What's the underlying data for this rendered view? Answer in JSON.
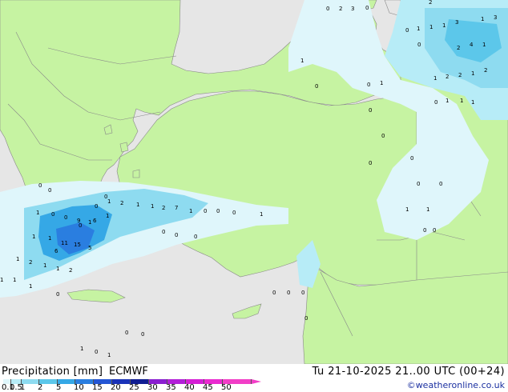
{
  "footer": {
    "title": "Precipitation [mm]",
    "model": "ECMWF",
    "datetime": "Tu 21-10-2025 21..00 UTC (00+24)",
    "credit": "©weatheronline.co.uk"
  },
  "legend": [
    {
      "label": "0.1",
      "color": "#dff6fb"
    },
    {
      "label": "0.5",
      "color": "#b7ecf7"
    },
    {
      "label": "1",
      "color": "#8edbf0"
    },
    {
      "label": "2",
      "color": "#5cc7ea"
    },
    {
      "label": "5",
      "color": "#35a8e6"
    },
    {
      "label": "10",
      "color": "#2a7ee0"
    },
    {
      "label": "15",
      "color": "#2556d4"
    },
    {
      "label": "20",
      "color": "#1a32b8"
    },
    {
      "label": "25",
      "color": "#101d92"
    },
    {
      "label": "30",
      "color": "#8a1fd0"
    },
    {
      "label": "35",
      "color": "#b21fd8"
    },
    {
      "label": "40",
      "color": "#d51fd5"
    },
    {
      "label": "45",
      "color": "#ea2ad0"
    },
    {
      "label": "50",
      "color": "#f23ec7"
    }
  ],
  "colors": {
    "sea": "#e6e6e6",
    "land": "#c6f3a2",
    "coast": "#888888",
    "border": "#888888"
  },
  "map_values": [
    {
      "t": "0"
    },
    {
      "t": "2"
    },
    {
      "t": "3"
    },
    {
      "t": "0"
    },
    {
      "t": "2"
    },
    {
      "t": "0"
    },
    {
      "t": "1"
    },
    {
      "t": "1"
    },
    {
      "t": "1"
    },
    {
      "t": "3"
    },
    {
      "t": "1"
    },
    {
      "t": "0"
    },
    {
      "t": "2"
    },
    {
      "t": "4"
    },
    {
      "t": "1"
    },
    {
      "t": "3"
    },
    {
      "t": "1"
    },
    {
      "t": "2"
    },
    {
      "t": "2"
    },
    {
      "t": "1"
    },
    {
      "t": "2"
    },
    {
      "t": "1"
    },
    {
      "t": "0"
    },
    {
      "t": "0"
    },
    {
      "t": "1"
    },
    {
      "t": "0"
    },
    {
      "t": "0"
    },
    {
      "t": "1"
    },
    {
      "t": "1"
    },
    {
      "t": "1"
    },
    {
      "t": "0"
    },
    {
      "t": "0"
    },
    {
      "t": "0"
    },
    {
      "t": "0"
    },
    {
      "t": "0"
    },
    {
      "t": "1"
    },
    {
      "t": "1"
    },
    {
      "t": "0"
    },
    {
      "t": "0"
    },
    {
      "t": "0"
    },
    {
      "t": "0"
    },
    {
      "t": "0"
    },
    {
      "t": "0"
    },
    {
      "t": "1"
    },
    {
      "t": "2"
    },
    {
      "t": "1"
    },
    {
      "t": "1"
    },
    {
      "t": "2"
    },
    {
      "t": "7"
    },
    {
      "t": "1"
    },
    {
      "t": "0"
    },
    {
      "t": "0"
    },
    {
      "t": "0"
    },
    {
      "t": "1"
    },
    {
      "t": "1"
    },
    {
      "t": "0"
    },
    {
      "t": "0"
    },
    {
      "t": "0"
    },
    {
      "t": "1"
    },
    {
      "t": "9"
    },
    {
      "t": "6"
    },
    {
      "t": "1"
    },
    {
      "t": "1"
    },
    {
      "t": "11"
    },
    {
      "t": "15"
    },
    {
      "t": "5"
    },
    {
      "t": "6"
    },
    {
      "t": "1"
    },
    {
      "t": "1"
    },
    {
      "t": "2"
    },
    {
      "t": "1"
    },
    {
      "t": "1"
    },
    {
      "t": "2"
    },
    {
      "t": "1"
    },
    {
      "t": "1"
    },
    {
      "t": "1"
    },
    {
      "t": "0"
    },
    {
      "t": "0"
    },
    {
      "t": "0"
    },
    {
      "t": "0"
    },
    {
      "t": "0"
    },
    {
      "t": "0"
    },
    {
      "t": "0"
    },
    {
      "t": "0"
    },
    {
      "t": "0"
    },
    {
      "t": "0"
    },
    {
      "t": "1"
    },
    {
      "t": "0"
    },
    {
      "t": "1"
    },
    {
      "t": "1"
    },
    {
      "t": "0"
    },
    {
      "t": "0"
    }
  ]
}
